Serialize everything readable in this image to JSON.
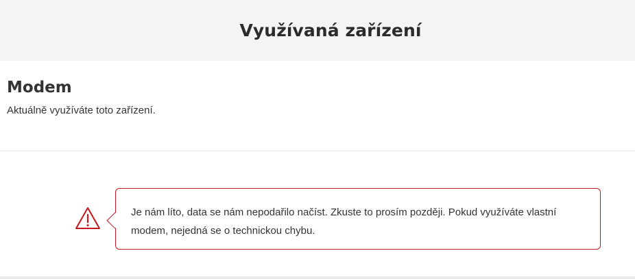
{
  "header": {
    "title": "Využívaná zařízení"
  },
  "device": {
    "name": "Modem",
    "description": "Aktuálně využíváte toto zařízení."
  },
  "alert": {
    "icon": "warning-triangle-icon",
    "message": "Je nám líto, data se nám nepodařilo načíst. Zkuste to prosím později. Pokud využíváte vlastní modem, nejedná se o technickou chybu.",
    "accent_color": "#c4161c"
  }
}
